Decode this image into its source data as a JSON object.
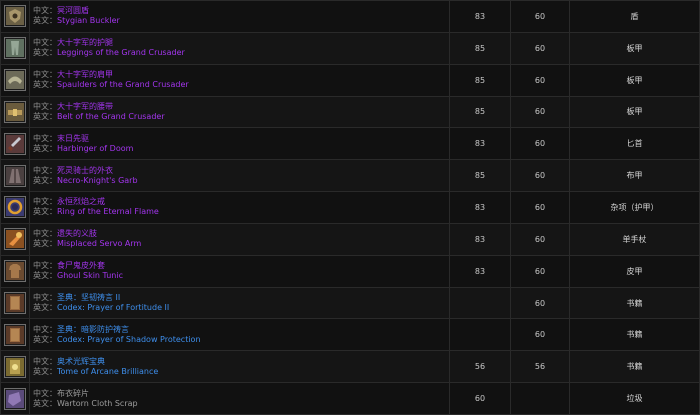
{
  "labels": {
    "zh_prefix": "中文：",
    "en_prefix": "英文："
  },
  "items": [
    {
      "icon": "shield-icon",
      "icon_color": "#6b6045",
      "quality_class": "q-epic",
      "zh": "冥河圆盾",
      "en": "Stygian Buckler",
      "v1": "83",
      "v2": "60",
      "type": "盾"
    },
    {
      "icon": "leggings-icon",
      "icon_color": "#5f7060",
      "quality_class": "q-epic",
      "zh": "大十字军的护腿",
      "en": "Leggings of the Grand Crusader",
      "v1": "85",
      "v2": "60",
      "type": "板甲"
    },
    {
      "icon": "shoulders-icon",
      "icon_color": "#6c6a58",
      "quality_class": "q-epic",
      "zh": "大十字军的肩甲",
      "en": "Spaulders of the Grand Crusader",
      "v1": "85",
      "v2": "60",
      "type": "板甲"
    },
    {
      "icon": "belt-icon",
      "icon_color": "#6a5b3d",
      "quality_class": "q-epic",
      "zh": "大十字军的腰带",
      "en": "Belt of the Grand Crusader",
      "v1": "85",
      "v2": "60",
      "type": "板甲"
    },
    {
      "icon": "dagger-icon",
      "icon_color": "#5a3a3a",
      "quality_class": "q-epic",
      "zh": "末日先驱",
      "en": "Harbinger of Doom",
      "v1": "83",
      "v2": "60",
      "type": "匕首"
    },
    {
      "icon": "robe-icon",
      "icon_color": "#4a4040",
      "quality_class": "q-epic",
      "zh": "死灵骑士的外衣",
      "en": "Necro-Knight's Garb",
      "v1": "85",
      "v2": "60",
      "type": "布甲"
    },
    {
      "icon": "ring-icon",
      "icon_color": "#3a3a70",
      "quality_class": "q-epic",
      "zh": "永恒烈焰之戒",
      "en": "Ring of the Eternal Flame",
      "v1": "83",
      "v2": "60",
      "type": "杂项（护甲）"
    },
    {
      "icon": "servo-arm-icon",
      "icon_color": "#8a5020",
      "quality_class": "q-epic",
      "zh": "遗失的义肢",
      "en": "Misplaced Servo Arm",
      "v1": "83",
      "v2": "60",
      "type": "单手杖"
    },
    {
      "icon": "tunic-icon",
      "icon_color": "#6a4a30",
      "quality_class": "q-epic",
      "zh": "食尸鬼皮外套",
      "en": "Ghoul Skin Tunic",
      "v1": "83",
      "v2": "60",
      "type": "皮甲"
    },
    {
      "icon": "book-icon",
      "icon_color": "#5a3a28",
      "quality_class": "q-rare",
      "zh": "圣典：坚韧祷言 II",
      "en": "Codex: Prayer of Fortitude II",
      "v1": "",
      "v2": "60",
      "type": "书籍"
    },
    {
      "icon": "book-icon",
      "icon_color": "#5a3a28",
      "quality_class": "q-rare",
      "zh": "圣典：暗影防护祷言",
      "en": "Codex: Prayer of Shadow Protection",
      "v1": "",
      "v2": "60",
      "type": "书籍"
    },
    {
      "icon": "tome-icon",
      "icon_color": "#7a6a30",
      "quality_class": "q-rare",
      "zh": "奥术光辉宝典",
      "en": "Tome of Arcane Brilliance",
      "v1": "56",
      "v2": "56",
      "type": "书籍"
    },
    {
      "icon": "cloth-scrap-icon",
      "icon_color": "#5a4a7a",
      "quality_class": "q-common",
      "zh": "布衣碎片",
      "en": "Wartorn Cloth Scrap",
      "v1": "60",
      "v2": "",
      "type": "垃圾"
    }
  ]
}
